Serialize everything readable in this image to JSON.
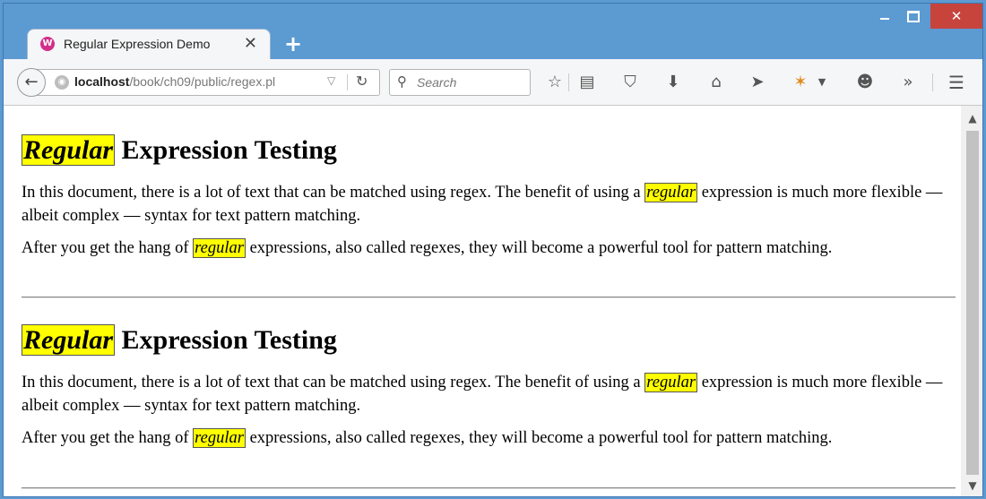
{
  "browser": {
    "tab_title": "Regular Expression Demo",
    "tab_close": "✕",
    "new_tab": "+",
    "window_controls": {
      "minimize": "",
      "maximize": "",
      "close": "✕"
    },
    "url_host": "localhost",
    "url_path": "/book/ch09/public/regex.pl",
    "search_placeholder": "Search",
    "toolbar_icons": [
      "bookmark-star-icon",
      "reading-list-icon",
      "pocket-icon",
      "download-icon",
      "home-icon",
      "send-icon",
      "extension-icon",
      "dropdown-icon",
      "chat-icon",
      "overflow-icon",
      "menu-icon"
    ]
  },
  "content": {
    "sections": [
      {
        "heading_highlight": "Regular",
        "heading_rest": " Expression Testing",
        "p1_before": "In this document, there is a lot of text that can be matched using regex. The benefit of using a ",
        "p1_highlight": "regular",
        "p1_after": " expression is much more flexible — albeit complex — syntax for text pattern matching.",
        "p2_before": "After you get the hang of ",
        "p2_highlight": "regular",
        "p2_after": " expressions, also called regexes, they will become a powerful tool for pattern matching."
      },
      {
        "heading_highlight": "Regular",
        "heading_rest": " Expression Testing",
        "p1_before": "In this document, there is a lot of text that can be matched using regex. The benefit of using a ",
        "p1_highlight": "regular",
        "p1_after": " expression is much more flexible — albeit complex — syntax for text pattern matching.",
        "p2_before": "After you get the hang of ",
        "p2_highlight": "regular",
        "p2_after": " expressions, also called regexes, they will become a powerful tool for pattern matching."
      }
    ],
    "highlight_color": "#ffff00"
  }
}
